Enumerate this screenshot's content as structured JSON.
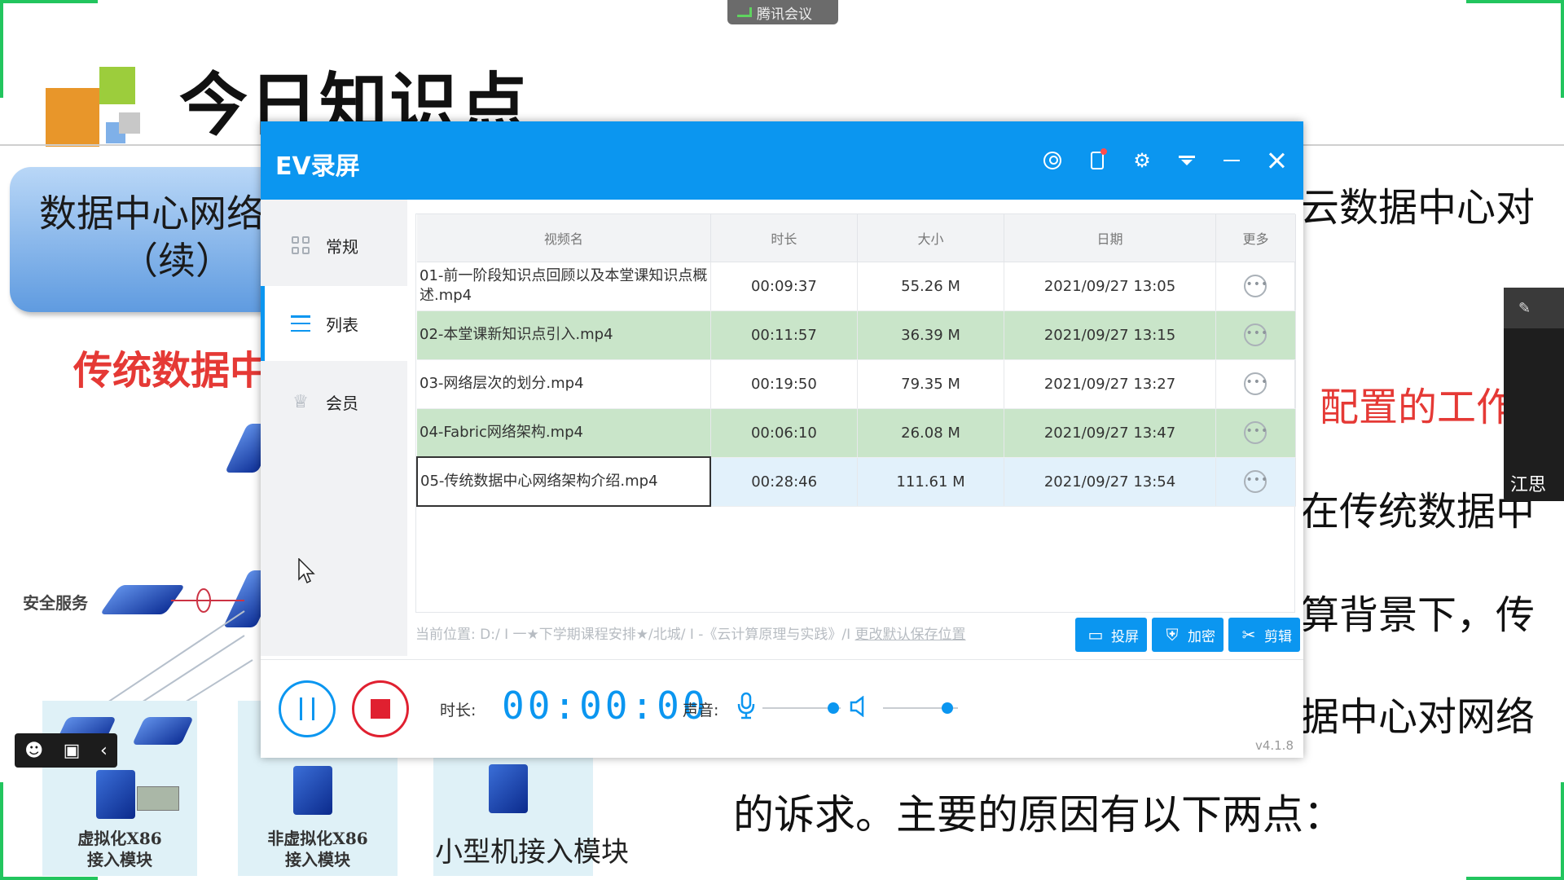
{
  "meeting": {
    "badge_label": "腾讯会议"
  },
  "slide": {
    "title": "今日知识点",
    "box_line1": "数据中心网络",
    "box_line2": "（续）",
    "red_heading": "传统数据中",
    "right_lines": [
      "云数据中心对",
      "在传统数据中",
      "算背景下，传",
      "据中心对网络"
    ],
    "right_red": "配置的工作",
    "bottom_line": "的诉求。主要的原因有以下两点：",
    "network_label": "安全服务",
    "modules": [
      "虚拟化X86\n接入模块",
      "非虚拟化X86\n接入模块",
      "小型机接入模块"
    ]
  },
  "video_tile": {
    "name": "江思"
  },
  "ev": {
    "title": "EV录屏",
    "nav": [
      {
        "label": "常规",
        "icon": "grid-icon"
      },
      {
        "label": "列表",
        "icon": "list-icon"
      },
      {
        "label": "会员",
        "icon": "crown-icon"
      }
    ],
    "table": {
      "headers": [
        "视频名",
        "时长",
        "大小",
        "日期",
        "更多"
      ],
      "rows": [
        {
          "name": "01-前一阶段知识点回顾以及本堂课知识点概述.mp4",
          "duration": "00:09:37",
          "size": "55.26 M",
          "date": "2021/09/27 13:05"
        },
        {
          "name": "02-本堂课新知识点引入.mp4",
          "duration": "00:11:57",
          "size": "36.39 M",
          "date": "2021/09/27 13:15"
        },
        {
          "name": "03-网络层次的划分.mp4",
          "duration": "00:19:50",
          "size": "79.35 M",
          "date": "2021/09/27 13:27"
        },
        {
          "name": "04-Fabric网络架构.mp4",
          "duration": "00:06:10",
          "size": "26.08 M",
          "date": "2021/09/27 13:47"
        },
        {
          "name": "05-传统数据中心网络架构介绍.mp4",
          "duration": "00:28:46",
          "size": "111.61 M",
          "date": "2021/09/27 13:54"
        }
      ]
    },
    "path_text": "当前位置: D:/ I 一★下学期课程安排★/北城/ I -《云计算原理与实践》/I",
    "path_link": "更改默认保存位置",
    "buttons": {
      "cast": "投屏",
      "encrypt": "加密",
      "edit": "剪辑"
    },
    "duration_label": "时长:",
    "duration_value": "00:00:00",
    "sound_label": "声音:",
    "version": "v4.1.8",
    "colors": {
      "accent": "#0b96f0",
      "stop": "#e02030",
      "row_highlight": "#c9e5c9"
    }
  }
}
